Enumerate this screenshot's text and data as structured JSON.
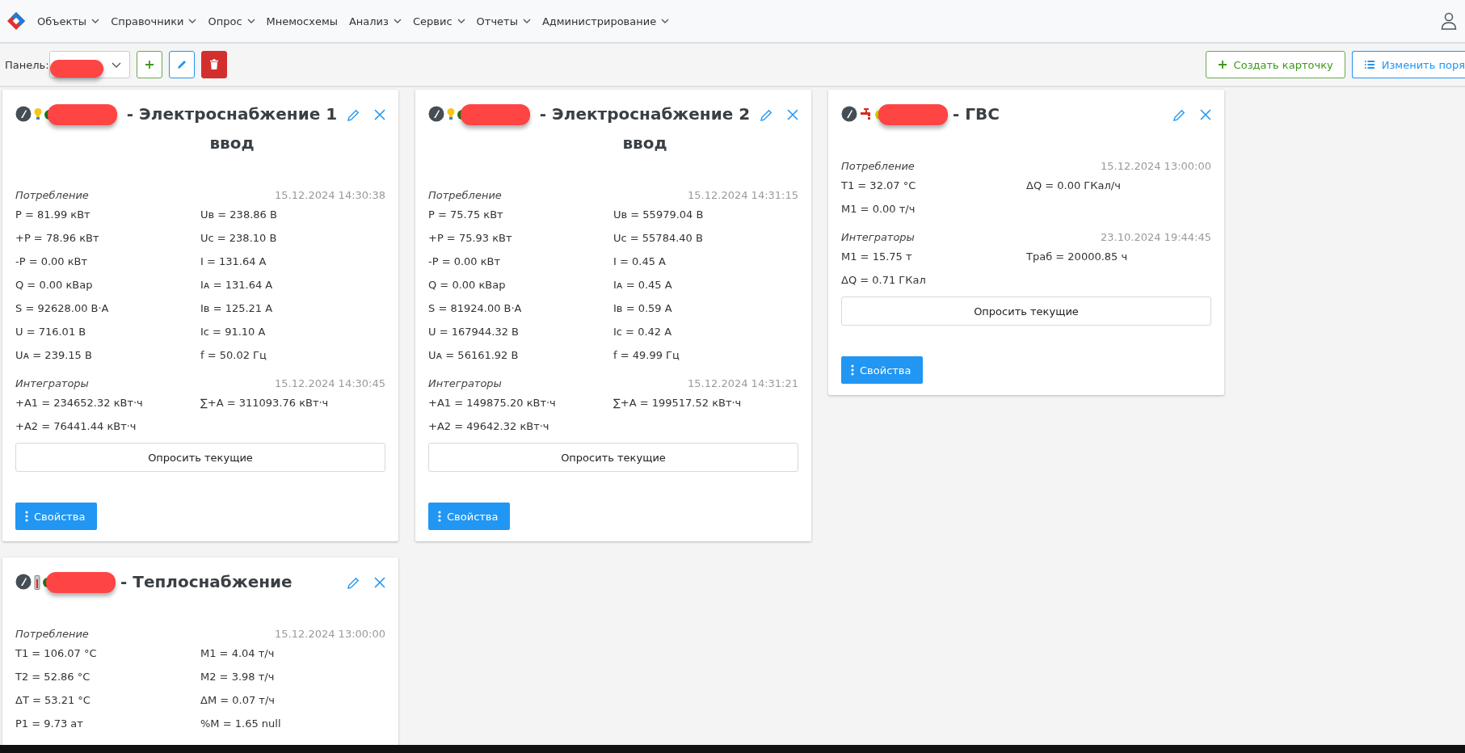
{
  "nav": {
    "items": [
      {
        "label": "Объекты",
        "dropdown": true
      },
      {
        "label": "Справочники",
        "dropdown": true
      },
      {
        "label": "Опрос",
        "dropdown": true
      },
      {
        "label": "Мнемосхемы",
        "dropdown": false
      },
      {
        "label": "Анализ",
        "dropdown": true
      },
      {
        "label": "Сервис",
        "dropdown": true
      },
      {
        "label": "Отчеты",
        "dropdown": true
      },
      {
        "label": "Администрирование",
        "dropdown": true
      }
    ]
  },
  "toolbar": {
    "panel_label": "Панель:",
    "create_button": "Создать карточку",
    "reorder_button": "Изменить поря"
  },
  "cards": [
    {
      "kind": "electric",
      "color": "#1e7b1e",
      "title": "- Электроснабжение 1 ввод",
      "sections": [
        {
          "label": "Потребление",
          "timestamp": "15.12.2024 14:30:38",
          "values": [
            "P = 81.99 кВт",
            "Uв = 238.86 В",
            "+P = 78.96 кВт",
            "Uc = 238.10 В",
            "-P = 0.00 кВт",
            "I = 131.64 А",
            "Q = 0.00 кВар",
            "Iᴀ = 131.64 А",
            "S = 92628.00 В·А",
            "Iв = 125.21 А",
            "U = 716.01 В",
            "Ic = 91.10 А",
            "Uᴀ = 239.15 В",
            "f = 50.02 Гц"
          ]
        },
        {
          "label": "Интеграторы",
          "timestamp": "15.12.2024 14:30:45",
          "values": [
            "+A1 = 234652.32 кВт·ч",
            "∑+A = 311093.76 кВт·ч",
            "+A2 = 76441.44 кВт·ч"
          ]
        }
      ],
      "poll_button": "Опросить текущие",
      "properties_button": "Свойства"
    },
    {
      "kind": "electric",
      "color": "#1e7b1e",
      "title": "- Электроснабжение 2 ввод",
      "sections": [
        {
          "label": "Потребление",
          "timestamp": "15.12.2024 14:31:15",
          "values": [
            "P = 75.75 кВт",
            "Uв = 55979.04 В",
            "+P = 75.93 кВт",
            "Uc = 55784.40 В",
            "-P = 0.00 кВт",
            "I = 0.45 А",
            "Q = 0.00 кВар",
            "Iᴀ = 0.45 А",
            "S = 81924.00 В·А",
            "Iв = 0.59 А",
            "U = 167944.32 В",
            "Ic = 0.42 А",
            "Uᴀ = 56161.92 В",
            "f = 49.99 Гц"
          ]
        },
        {
          "label": "Интеграторы",
          "timestamp": "15.12.2024 14:31:21",
          "values": [
            "+A1 = 149875.20 кВт·ч",
            "∑+A = 199517.52 кВт·ч",
            "+A2 = 49642.32 кВт·ч"
          ]
        }
      ],
      "poll_button": "Опросить текущие",
      "properties_button": "Свойства"
    },
    {
      "kind": "hotwater",
      "color": "#d4d400",
      "title": "- ГВС",
      "sections": [
        {
          "label": "Потребление",
          "timestamp": "15.12.2024 13:00:00",
          "values": [
            "T1 = 32.07 °C",
            "ΔQ = 0.00 ГКал/ч",
            "M1 = 0.00 т/ч"
          ]
        },
        {
          "label": "Интеграторы",
          "timestamp": "23.10.2024 19:44:45",
          "values": [
            "M1 = 15.75 т",
            "Траб = 20000.85 ч",
            "ΔQ = 0.71 ГКал"
          ]
        }
      ],
      "poll_button": "Опросить текущие",
      "properties_button": "Свойства"
    },
    {
      "kind": "heating",
      "color": "#1e7b1e",
      "title": "- Теплоснабжение",
      "sections": [
        {
          "label": "Потребление",
          "timestamp": "15.12.2024 13:00:00",
          "values": [
            "T1 = 106.07 °C",
            "M1 = 4.04 т/ч",
            "T2 = 52.86 °C",
            "M2 = 3.98 т/ч",
            "ΔT = 53.21 °C",
            "ΔM = 0.07 т/ч",
            "P1 = 9.73 ат",
            "%M = 1.65 null"
          ]
        }
      ]
    }
  ]
}
